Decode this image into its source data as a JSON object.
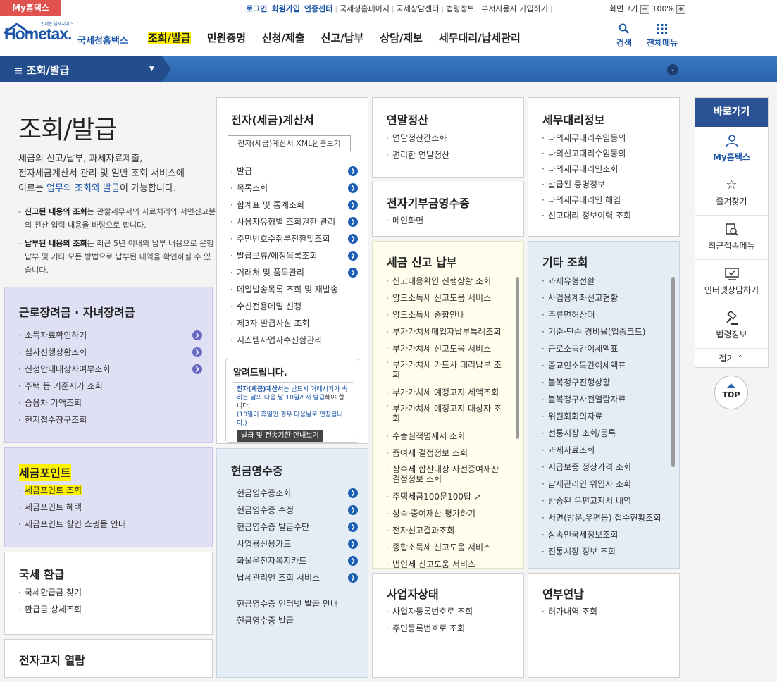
{
  "topbar": {
    "my_label": "My홈택스",
    "links": [
      "로그인",
      "회원가입",
      "인증센터",
      "국세청홈페이지",
      "국세상담센터",
      "법령정보",
      "부서사용자 가입하기"
    ],
    "zoom_label": "화면크기",
    "zoom_minus": "−",
    "zoom_value": "100%",
    "zoom_plus": "+"
  },
  "header": {
    "logo_main": "Hometax.",
    "logo_sub": "국세청홈택스",
    "logo_tiny": "언제든 납세서비스",
    "nav": [
      "조회/발급",
      "민원증명",
      "신청/제출",
      "신고/납부",
      "상담/제보",
      "세무대리/납세관리"
    ],
    "search_label": "검색",
    "allmenu_label": "전체메뉴"
  },
  "bluebar": {
    "title": "조회/발급"
  },
  "intro": {
    "title": "조회/발급",
    "desc_1": "세금의 신고/납부, 과세자료제출,",
    "desc_2": "전자세금계산서 관리 및 일반 조회 서비스에",
    "desc_3": "이르는 ",
    "desc_link": "업무의 조회와 발급",
    "desc_4": "이 가능합니다.",
    "note1_bold": "신고된 내용의 조회",
    "note1": "는 관할세무서의 자료처리와 서면신고분의 전산 입력 내용을 바탕으로 합니다.",
    "note2_bold": "납부된 내용의 조회",
    "note2": "는 최근 5년 이내의 납부 내용으로 은행 납부 및 기타 모든 방법으로 납부된 내역을 확인하실 수 있습니다."
  },
  "col1": {
    "b1": {
      "title": "근로장려금 · 자녀장려금",
      "items": [
        "소득자료확인하기",
        "심사진행상황조회",
        "신청안내대상자여부조회",
        "주택 등 기준시가 조회",
        "승용차 가액조회",
        "현지접수창구조회"
      ]
    },
    "b2": {
      "title": "세금포인트",
      "items": [
        "세금포인트 조회",
        "세금포인트 혜택",
        "세금포인트 할인 쇼핑몰 안내"
      ]
    },
    "b3": {
      "title": "국세 환급",
      "items": [
        "국세환급금 찾기",
        "환급금 상세조회"
      ]
    },
    "b4": {
      "title": "전자고지 열람"
    }
  },
  "col2": {
    "b1": {
      "title": "전자(세금)계산서",
      "button": "전자(세금)계산서 XML원본보기",
      "items": [
        "발급",
        "목록조회",
        "합계표 및 통계조회",
        "사용자유형별 조회권한 관리",
        "주민번호수취분전환및조회",
        "발급보류/예정목록조회",
        "거래처 및 품목관리",
        "메일발송목록 조회 및 재발송",
        "수신전용메일 신청",
        "제3자 발급사실 조회",
        "시스템사업자수신함관리"
      ],
      "notice": {
        "title": "알려드립니다.",
        "t1": "전자(세금)계산서",
        "t2": "는 반드시 거래시기가 속하는 달의 다음 달 10일까지 발급",
        "t3": "해야 합니다.",
        "t4": "(10일이 휴일인 경우 다음날로 연장됩니다.)",
        "btn": "발급 및 전송기한 안내보기"
      }
    },
    "b2": {
      "title": "현금영수증",
      "items": [
        "현금영수증조회",
        "현금영수증 수정",
        "현금영수증 발급수단",
        "사업용신용카드",
        "화물운전자복지카드",
        "납세관리인 조회 서비스"
      ],
      "items2": [
        "현금영수증 인터넷 발급 안내",
        "현금영수증 발급"
      ]
    }
  },
  "col3": {
    "b1": {
      "title": "연말정산",
      "items": [
        "연말정산간소화",
        "편리한 연말정산"
      ]
    },
    "b2": {
      "title": "전자기부금영수증",
      "items": [
        "메인화면"
      ]
    },
    "b3": {
      "title": "세금 신고 납부",
      "items": [
        "신고내용확인 진행상황 조회",
        "양도소득세 신고도움 서비스",
        "양도소득세 종합안내",
        "부가가치세매입자납부특례조회",
        "부가가치세 신고도움 서비스",
        "부가가치세 카드사 대리납부 조회",
        "부가가치세 예정고지 세액조회",
        "부가가치세 예정고지 대상자 조회",
        "수출실적명세서 조회",
        "증여세 결정정보 조회",
        "상속세 합산대상 사전증여재산 결정정보 조회",
        "주택세금100문100답",
        "상속·증여재산 평가하기",
        "전자신고결과조회",
        "종합소득세 신고도움 서비스",
        "법인세 신고도움 서비스"
      ]
    },
    "b4": {
      "title": "사업자상태",
      "items": [
        "사업자등록번호로 조회",
        "주민등록번호로 조회"
      ]
    }
  },
  "col4": {
    "b1": {
      "title": "세무대리정보",
      "items": [
        "나의세무대리수임동의",
        "나의신고대리수임동의",
        "나의세무대리인조회",
        "발급된 증명정보",
        "나의세무대리인 해임",
        "신고대리 정보이력 조회"
      ]
    },
    "b2": {
      "title": "기타 조회",
      "items": [
        "과세유형전환",
        "사업용계좌신고현황",
        "주류면허상태",
        "기준·단순 경비율(업종코드)",
        "근로소득간이세액표",
        "종교인소득간이세액표",
        "불복청구진행상황",
        "불복청구사전열람자료",
        "위원회회의자료",
        "전통시장 조회/등록",
        "과세자료조회",
        "지급보증 정상가격 조회",
        "납세관리인 위임자 조회",
        "반송된 우편고지서 내역",
        "서면(방문,우편등) 접수현황조회",
        "상속인국세정보조회",
        "전통시장 정보 조회"
      ]
    },
    "b3": {
      "title": "연부연납",
      "items": [
        "허가내역 조회"
      ]
    }
  },
  "sidebar": {
    "title": "바로가기",
    "items": [
      "My홈택스",
      "즐겨찾기",
      "최근접속메뉴",
      "인터넷상담하기",
      "법령정보"
    ],
    "fold": "접기 ⌃",
    "top": "TOP"
  }
}
